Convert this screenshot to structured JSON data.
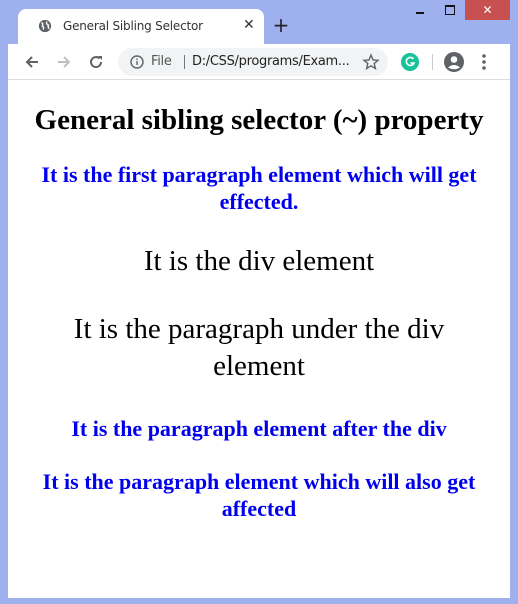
{
  "browser": {
    "tab": {
      "title": "General Sibling Selector",
      "favicon": "globe-icon",
      "close_icon": "close-icon"
    },
    "new_tab_label": "+",
    "window_controls": {
      "minimize": "minimize-icon",
      "maximize": "maximize-icon",
      "close": "✕"
    },
    "toolbar": {
      "back": "back-arrow-icon",
      "forward": "forward-arrow-icon",
      "reload": "reload-icon",
      "scheme_label": "File",
      "url": "D:/CSS/programs/Exam...",
      "bookmark": "star-icon",
      "extension": "grammarly-icon",
      "profile": "profile-icon",
      "menu": "kebab-menu-icon"
    },
    "colors": {
      "frame": "#9fb0ee",
      "close_button": "#c75050",
      "grammarly": "#15c39a",
      "link_blue": "#0000ee"
    }
  },
  "page": {
    "heading": "General sibling selector (~) property",
    "paragraph_first": "It is the first paragraph element which will get effected.",
    "div_text": "It is the div element",
    "div_paragraph": "It is the paragraph under the div element",
    "paragraph_after_div": "It is the paragraph element after the div",
    "paragraph_also_affected": "It is the paragraph element which will also get affected"
  }
}
